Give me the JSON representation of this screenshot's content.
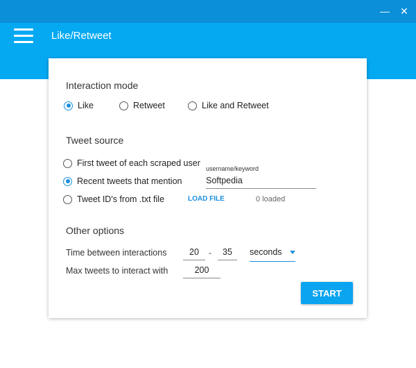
{
  "window": {
    "minimize_glyph": "—",
    "close_glyph": "✕"
  },
  "appbar": {
    "title": "Like/Retweet",
    "menu_icon": "hamburger-menu-icon"
  },
  "interaction_mode": {
    "title": "Interaction mode",
    "options": [
      {
        "label": "Like",
        "checked": true
      },
      {
        "label": "Retweet",
        "checked": false
      },
      {
        "label": "Like and Retweet",
        "checked": false
      }
    ]
  },
  "tweet_source": {
    "title": "Tweet source",
    "options": [
      {
        "label": "First tweet of each scraped user",
        "checked": false
      },
      {
        "label": "Recent tweets that mention",
        "checked": true
      },
      {
        "label": "Tweet ID's from .txt file",
        "checked": false
      }
    ],
    "keyword_label": "username/keyword",
    "keyword_value": "Softpedia",
    "load_file_label": "LOAD FILE",
    "loaded_status": "0 loaded"
  },
  "other_options": {
    "title": "Other options",
    "time_label": "Time between interactions",
    "time_min": "20",
    "time_separator": "-",
    "time_max": "35",
    "time_unit": "seconds",
    "max_label": "Max tweets to interact with",
    "max_value": "200"
  },
  "start_label": "START",
  "colors": {
    "titlebar": "#0a8fd8",
    "appbar": "#05a9f2",
    "accent": "#1a8fe0"
  }
}
